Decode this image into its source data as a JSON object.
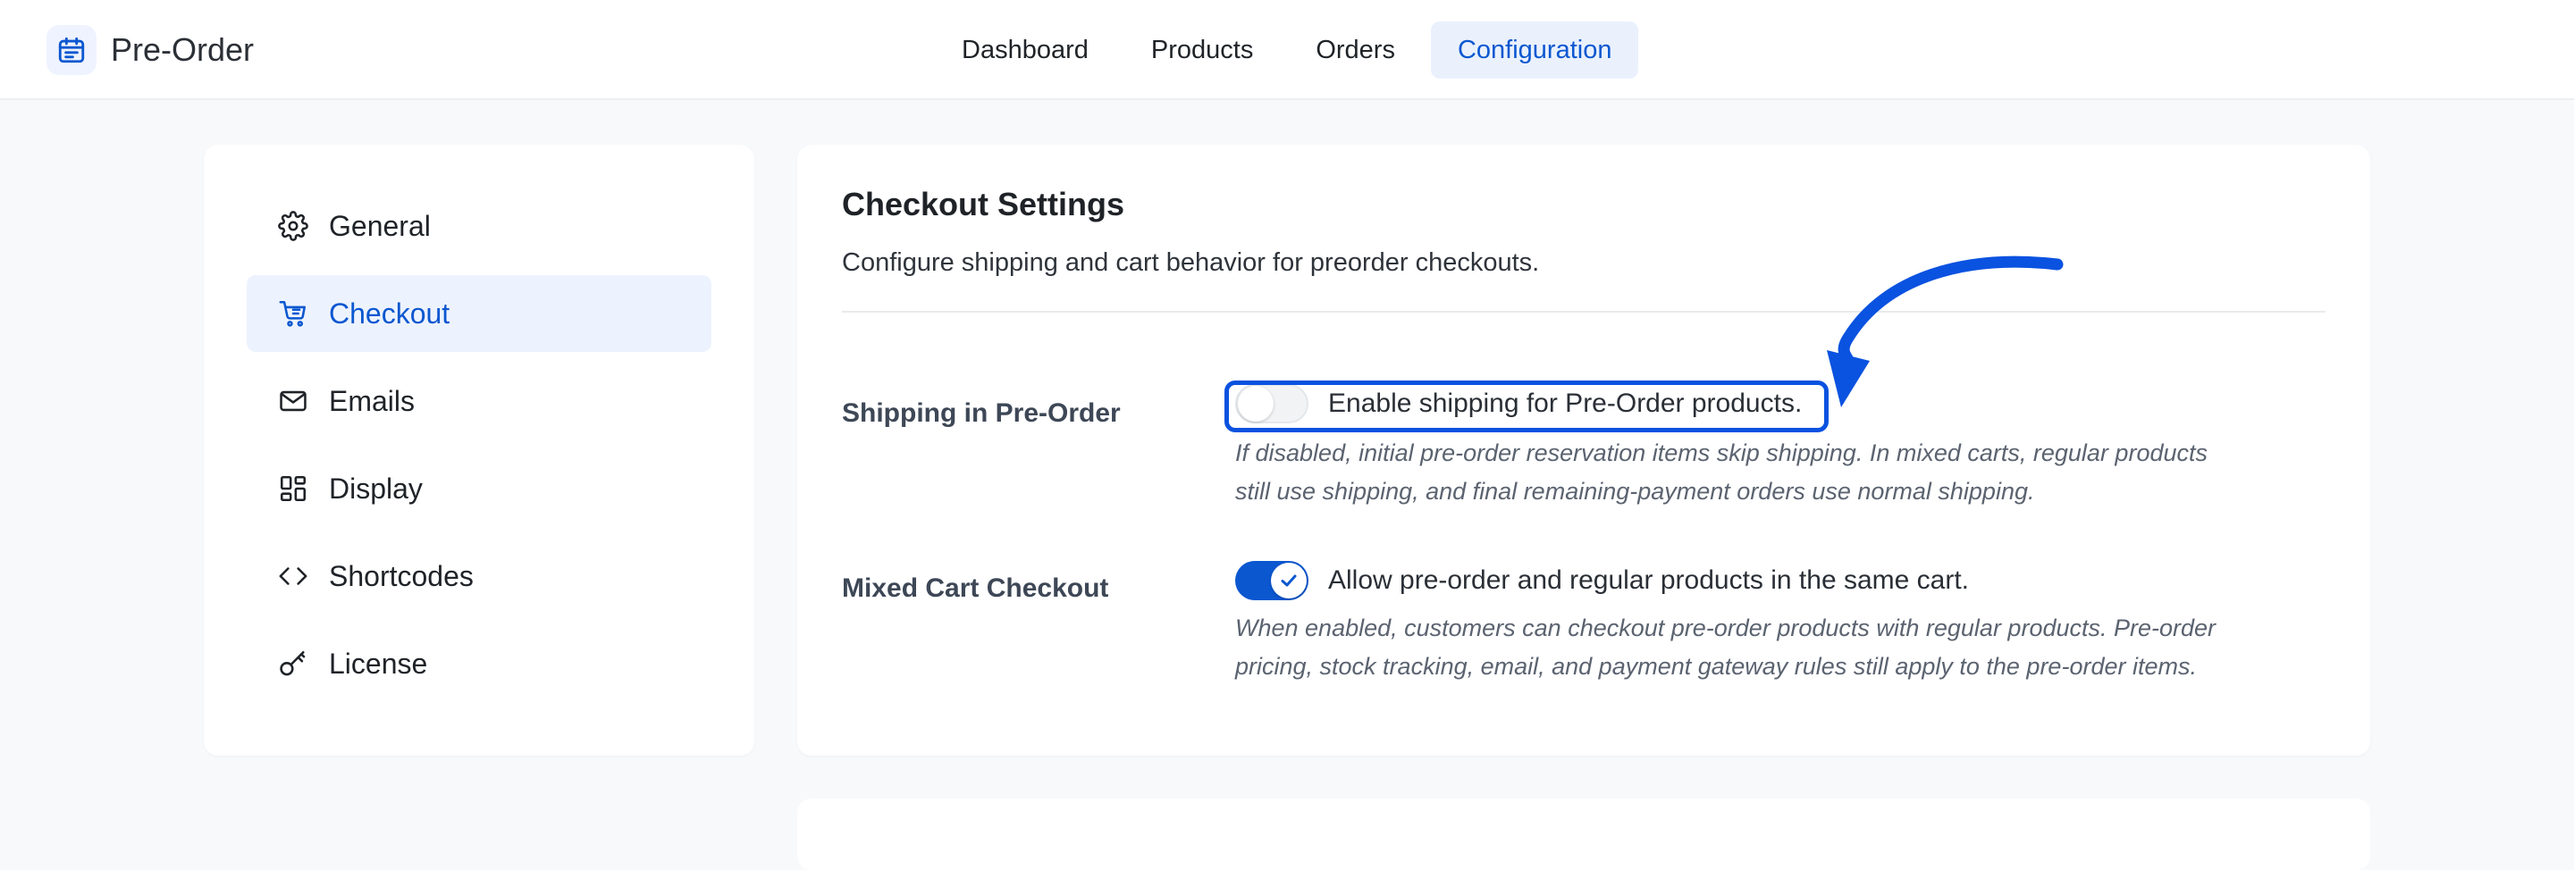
{
  "header": {
    "app_title": "Pre-Order",
    "app_icon": "calendar-icon",
    "nav": [
      {
        "label": "Dashboard",
        "active": false
      },
      {
        "label": "Products",
        "active": false
      },
      {
        "label": "Orders",
        "active": false
      },
      {
        "label": "Configuration",
        "active": true
      }
    ]
  },
  "sidebar": {
    "items": [
      {
        "label": "General",
        "icon": "gear-icon",
        "active": false
      },
      {
        "label": "Checkout",
        "icon": "cart-icon",
        "active": true
      },
      {
        "label": "Emails",
        "icon": "mail-icon",
        "active": false
      },
      {
        "label": "Display",
        "icon": "layout-icon",
        "active": false
      },
      {
        "label": "Shortcodes",
        "icon": "code-icon",
        "active": false
      },
      {
        "label": "License",
        "icon": "key-icon",
        "active": false
      }
    ]
  },
  "checkout": {
    "title": "Checkout Settings",
    "description": "Configure shipping and cart behavior for preorder checkouts.",
    "shipping": {
      "label": "Shipping in Pre-Order",
      "toggle_text": "Enable shipping for Pre-Order products.",
      "enabled": false,
      "help_line1": "If disabled, initial pre-order reservation items skip shipping. In mixed carts, regular products",
      "help_line2": "still use shipping, and final remaining-payment orders use normal shipping."
    },
    "mixed_cart": {
      "label": "Mixed Cart Checkout",
      "toggle_text": "Allow pre-order and regular products in the same cart.",
      "enabled": true,
      "help_line1": "When enabled, customers can checkout pre-order products with regular products. Pre-order",
      "help_line2": "pricing, stock tracking, email, and payment gateway rules still apply to the pre-order items."
    }
  },
  "colors": {
    "accent": "#0b57d0",
    "annotation": "#0a52e0"
  }
}
